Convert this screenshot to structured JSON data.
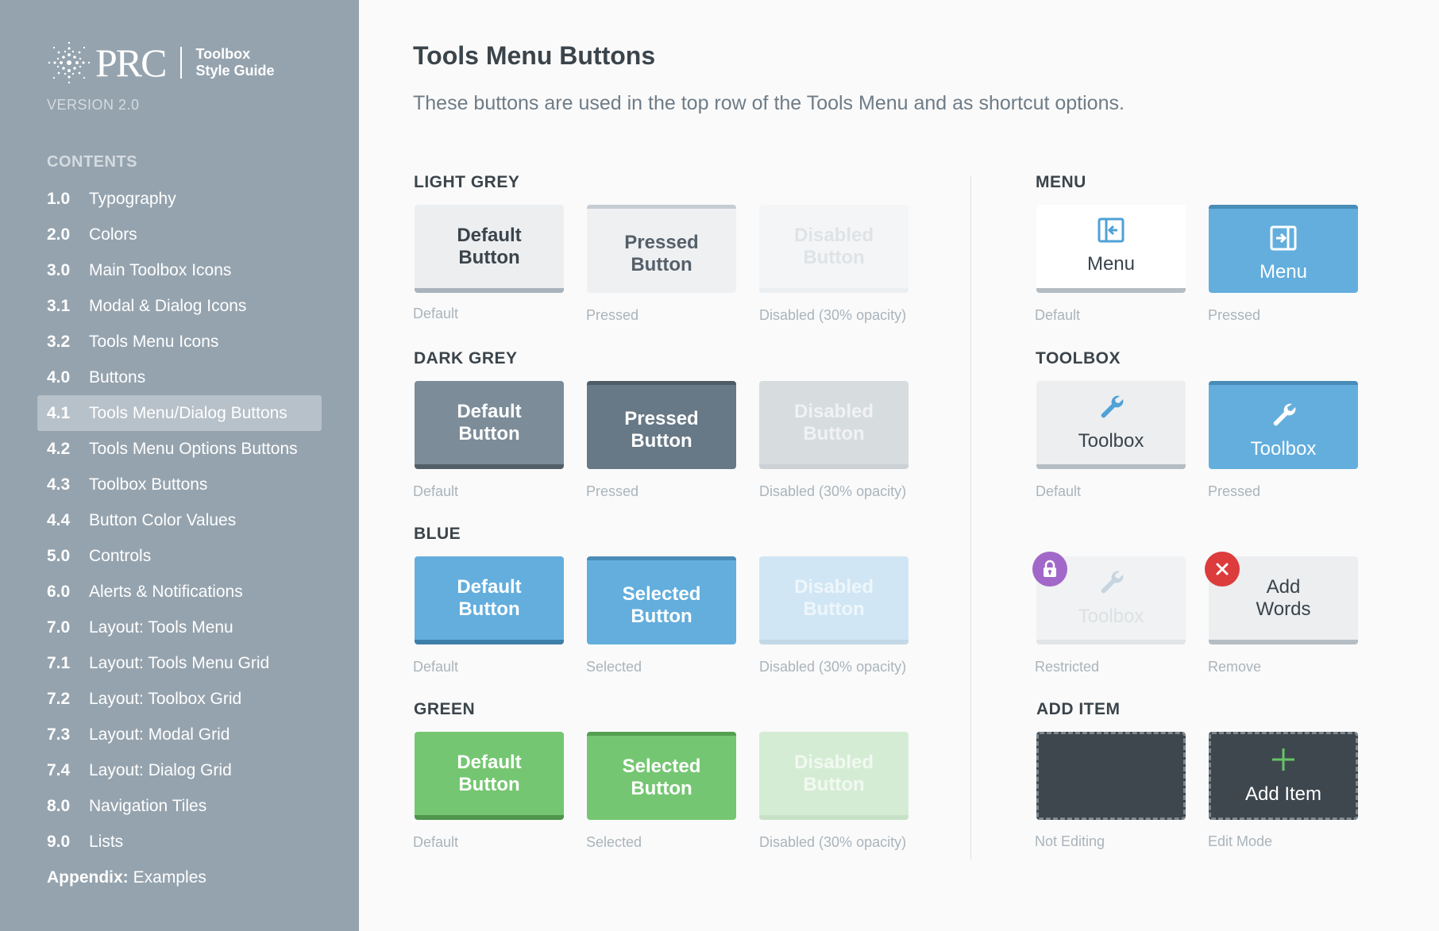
{
  "sidebar": {
    "logo_text": "PRC",
    "logo_sub_1": "Toolbox",
    "logo_sub_2": "Style Guide",
    "version": "VERSION 2.0",
    "contents_heading": "CONTENTS",
    "items": [
      {
        "num": "1.0",
        "label": "Typography"
      },
      {
        "num": "2.0",
        "label": "Colors"
      },
      {
        "num": "3.0",
        "label": "Main Toolbox Icons"
      },
      {
        "num": "3.1",
        "label": "Modal & Dialog Icons"
      },
      {
        "num": "3.2",
        "label": "Tools Menu Icons"
      },
      {
        "num": "4.0",
        "label": "Buttons"
      },
      {
        "num": "4.1",
        "label": "Tools Menu/Dialog Buttons"
      },
      {
        "num": "4.2",
        "label": "Tools Menu Options Buttons"
      },
      {
        "num": "4.3",
        "label": "Toolbox Buttons"
      },
      {
        "num": "4.4",
        "label": "Button Color Values"
      },
      {
        "num": "5.0",
        "label": "Controls"
      },
      {
        "num": "6.0",
        "label": "Alerts & Notifications"
      },
      {
        "num": "7.0",
        "label": "Layout: Tools Menu"
      },
      {
        "num": "7.1",
        "label": "Layout: Tools Menu Grid"
      },
      {
        "num": "7.2",
        "label": "Layout: Toolbox Grid"
      },
      {
        "num": "7.3",
        "label": "Layout: Modal Grid"
      },
      {
        "num": "7.4",
        "label": "Layout: Dialog Grid"
      },
      {
        "num": "8.0",
        "label": "Navigation Tiles"
      },
      {
        "num": "9.0",
        "label": "Lists"
      },
      {
        "num": "Appendix:",
        "label": "Examples"
      }
    ],
    "active_index": 6
  },
  "main": {
    "title": "Tools Menu Buttons",
    "description": "These buttons are used in the top row of the Tools Menu and as shortcut options.",
    "light_grey": {
      "heading": "LIGHT GREY",
      "default": {
        "line1": "Default",
        "line2": "Button",
        "caption": "Default"
      },
      "pressed": {
        "line1": "Pressed",
        "line2": "Button",
        "caption": "Pressed"
      },
      "disabled": {
        "line1": "Disabled",
        "line2": "Button",
        "caption": "Disabled (30% opacity)"
      }
    },
    "dark_grey": {
      "heading": "DARK GREY",
      "default": {
        "line1": "Default",
        "line2": "Button",
        "caption": "Default"
      },
      "pressed": {
        "line1": "Pressed",
        "line2": "Button",
        "caption": "Pressed"
      },
      "disabled": {
        "line1": "Disabled",
        "line2": "Button",
        "caption": "Disabled (30% opacity)"
      }
    },
    "blue": {
      "heading": "BLUE",
      "default": {
        "line1": "Default",
        "line2": "Button",
        "caption": "Default"
      },
      "selected": {
        "line1": "Selected",
        "line2": "Button",
        "caption": "Selected"
      },
      "disabled": {
        "line1": "Disabled",
        "line2": "Button",
        "caption": "Disabled (30% opacity)"
      }
    },
    "green": {
      "heading": "GREEN",
      "default": {
        "line1": "Default",
        "line2": "Button",
        "caption": "Default"
      },
      "selected": {
        "line1": "Selected",
        "line2": "Button",
        "caption": "Selected"
      },
      "disabled": {
        "line1": "Disabled",
        "line2": "Button",
        "caption": "Disabled (30% opacity)"
      }
    },
    "menu": {
      "heading": "MENU",
      "default": {
        "label": "Menu",
        "caption": "Default",
        "icon": "menu-collapse-icon"
      },
      "pressed": {
        "label": "Menu",
        "caption": "Pressed",
        "icon": "menu-expand-icon"
      }
    },
    "toolbox": {
      "heading": "TOOLBOX",
      "default": {
        "label": "Toolbox",
        "caption": "Default",
        "icon": "wrench-icon"
      },
      "pressed": {
        "label": "Toolbox",
        "caption": "Pressed",
        "icon": "wrench-icon"
      },
      "restricted": {
        "label": "Toolbox",
        "caption": "Restricted",
        "icon": "wrench-icon",
        "badge": "lock-icon"
      },
      "remove": {
        "line1": "Add",
        "line2": "Words",
        "caption": "Remove",
        "badge": "close-icon"
      }
    },
    "add_item": {
      "heading": "ADD ITEM",
      "not_editing": {
        "caption": "Not Editing"
      },
      "edit_mode": {
        "label": "Add Item",
        "caption": "Edit Mode",
        "icon": "plus-icon"
      }
    },
    "colors": {
      "sidebar_bg": "#95a3ae",
      "blue": "#63aedd",
      "green": "#75c672",
      "dark_grey": "#7c8c98",
      "lock_badge": "#a268c9",
      "remove_badge": "#dc3c3c"
    }
  }
}
